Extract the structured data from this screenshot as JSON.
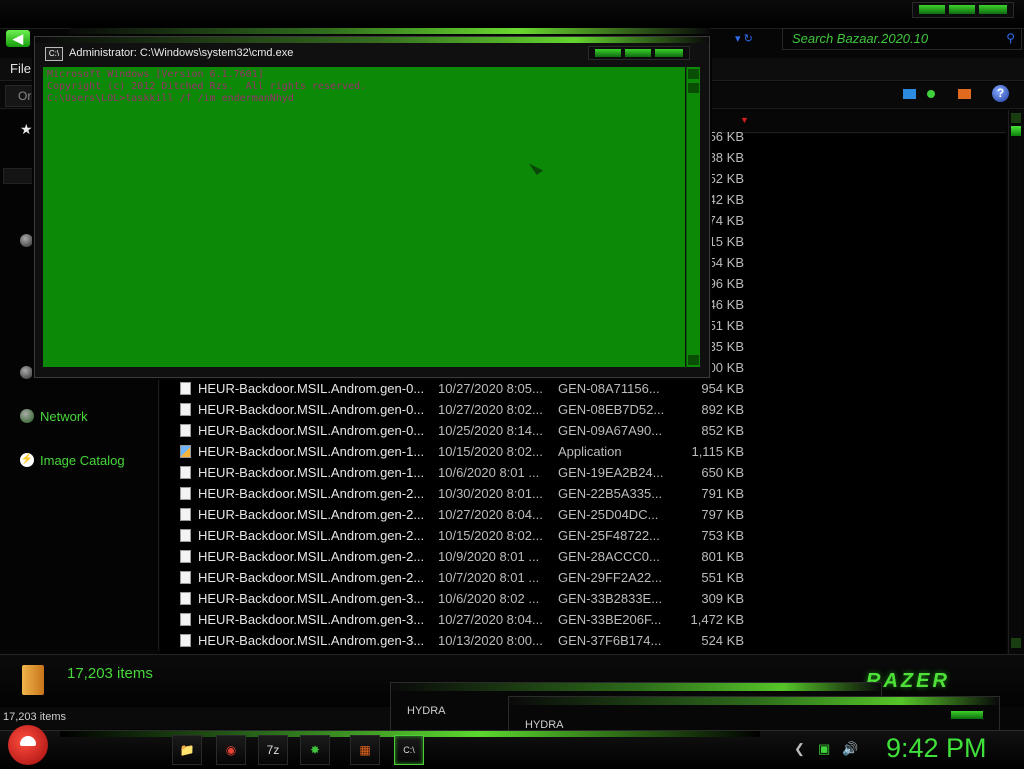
{
  "explorer": {
    "search_placeholder": "Search Bazaar.2020.10",
    "menu_file": "File",
    "organize": "Org",
    "nav": {
      "network": "Network",
      "image_catalog": "Image Catalog"
    },
    "partial_sizes": [
      "56 KB",
      "88 KB",
      "52 KB",
      "42 KB",
      "74 KB",
      "15 KB",
      "54 KB",
      "96 KB",
      "46 KB",
      "51 KB",
      "35 KB",
      "00 KB"
    ],
    "rows": [
      {
        "name": "HEUR-Backdoor.MSIL.Androm.gen-0...",
        "date": "10/27/2020 8:05...",
        "type": "GEN-08A71156...",
        "size": "954 KB",
        "icon": "file"
      },
      {
        "name": "HEUR-Backdoor.MSIL.Androm.gen-0...",
        "date": "10/27/2020 8:02...",
        "type": "GEN-08EB7D52...",
        "size": "892 KB",
        "icon": "file"
      },
      {
        "name": "HEUR-Backdoor.MSIL.Androm.gen-0...",
        "date": "10/25/2020 8:14...",
        "type": "GEN-09A67A90...",
        "size": "852 KB",
        "icon": "file"
      },
      {
        "name": "HEUR-Backdoor.MSIL.Androm.gen-1...",
        "date": "10/15/2020 8:02...",
        "type": "Application",
        "size": "1,115 KB",
        "icon": "app"
      },
      {
        "name": "HEUR-Backdoor.MSIL.Androm.gen-1...",
        "date": "10/6/2020 8:01 ...",
        "type": "GEN-19EA2B24...",
        "size": "650 KB",
        "icon": "file"
      },
      {
        "name": "HEUR-Backdoor.MSIL.Androm.gen-2...",
        "date": "10/30/2020 8:01...",
        "type": "GEN-22B5A335...",
        "size": "791 KB",
        "icon": "file"
      },
      {
        "name": "HEUR-Backdoor.MSIL.Androm.gen-2...",
        "date": "10/27/2020 8:04...",
        "type": "GEN-25D04DC...",
        "size": "797 KB",
        "icon": "file"
      },
      {
        "name": "HEUR-Backdoor.MSIL.Androm.gen-2...",
        "date": "10/15/2020 8:02...",
        "type": "GEN-25F48722...",
        "size": "753 KB",
        "icon": "file"
      },
      {
        "name": "HEUR-Backdoor.MSIL.Androm.gen-2...",
        "date": "10/9/2020 8:01 ...",
        "type": "GEN-28ACCC0...",
        "size": "801 KB",
        "icon": "file"
      },
      {
        "name": "HEUR-Backdoor.MSIL.Androm.gen-2...",
        "date": "10/7/2020 8:01 ...",
        "type": "GEN-29FF2A22...",
        "size": "551 KB",
        "icon": "file"
      },
      {
        "name": "HEUR-Backdoor.MSIL.Androm.gen-3...",
        "date": "10/6/2020 8:02 ...",
        "type": "GEN-33B2833E...",
        "size": "309 KB",
        "icon": "file"
      },
      {
        "name": "HEUR-Backdoor.MSIL.Androm.gen-3...",
        "date": "10/27/2020 8:04...",
        "type": "GEN-33BE206F...",
        "size": "1,472 KB",
        "icon": "file"
      },
      {
        "name": "HEUR-Backdoor.MSIL.Androm.gen-3...",
        "date": "10/13/2020 8:00...",
        "type": "GEN-37F6B174...",
        "size": "524 KB",
        "icon": "file"
      }
    ],
    "details_count": "17,203 items",
    "status_count": "17,203 items",
    "brand_logo": "RAZER"
  },
  "cmd": {
    "title": "Administrator: C:\\Windows\\system32\\cmd.exe",
    "lines": [
      "Microsoft Windows [Version 6.1.7601]",
      "Copyright (c) 2012 Ditched Rzs.  All rights reserved.",
      "",
      "C:\\Users\\LOL>taskkill /f /im endermanNhyd"
    ]
  },
  "hydra_windows": [
    {
      "title": "HYDRA"
    },
    {
      "title": "HYDRA"
    }
  ],
  "taskbar": {
    "clock": "9:42 PM",
    "apps": [
      "explorer-icon",
      "chrome-icon",
      "7zip-icon",
      "hydra-icon",
      "malware-icon",
      "cmd-icon"
    ]
  },
  "colors": {
    "accent": "#47d83a",
    "console_bg": "#0c8a07",
    "console_text": "#9a2e6b"
  }
}
